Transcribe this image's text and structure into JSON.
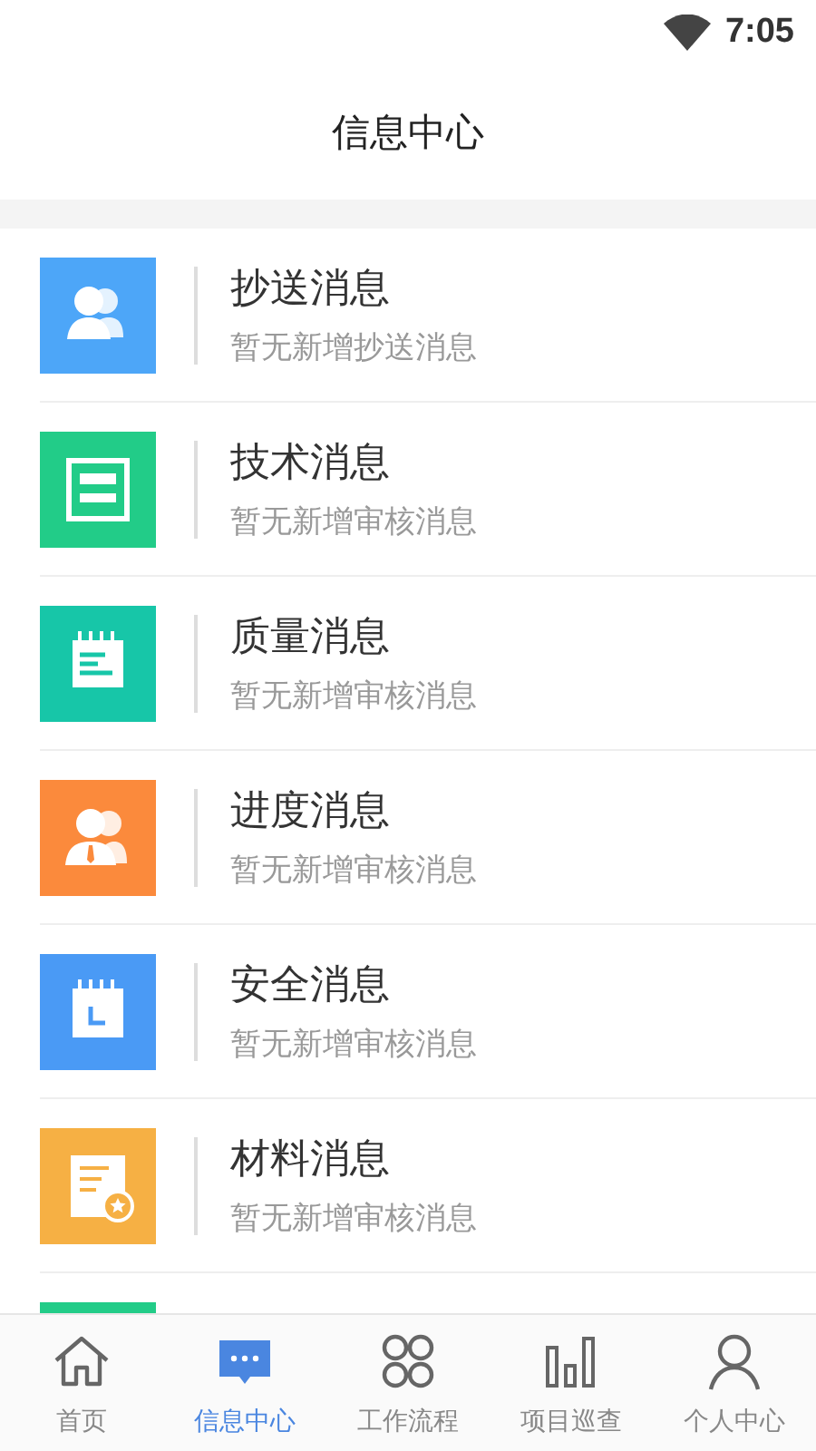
{
  "status_bar": {
    "time": "7:05"
  },
  "header": {
    "title": "信息中心"
  },
  "messages": [
    {
      "kind": "people",
      "color": "#4da6f8",
      "title": "抄送消息",
      "subtitle": "暂无新增抄送消息"
    },
    {
      "kind": "layout",
      "color": "#22cc88",
      "title": "技术消息",
      "subtitle": "暂无新增审核消息"
    },
    {
      "kind": "notepad",
      "color": "#17c6a8",
      "title": "质量消息",
      "subtitle": "暂无新增审核消息"
    },
    {
      "kind": "staff",
      "color": "#fb8a3c",
      "title": "进度消息",
      "subtitle": "暂无新增审核消息"
    },
    {
      "kind": "calendar",
      "color": "#4a9af5",
      "title": "安全消息",
      "subtitle": "暂无新增审核消息"
    },
    {
      "kind": "certificate",
      "color": "#f6b044",
      "title": "材料消息",
      "subtitle": "暂无新增审核消息"
    },
    {
      "kind": "blank",
      "color": "#22cc88"
    }
  ],
  "tabs": [
    {
      "kind": "home",
      "label": "首页",
      "selected": false
    },
    {
      "kind": "chat",
      "label": "信息中心",
      "selected": true
    },
    {
      "kind": "apps",
      "label": "工作流程",
      "selected": false
    },
    {
      "kind": "bars",
      "label": "项目巡查",
      "selected": false
    },
    {
      "kind": "person",
      "label": "个人中心",
      "selected": false
    }
  ]
}
